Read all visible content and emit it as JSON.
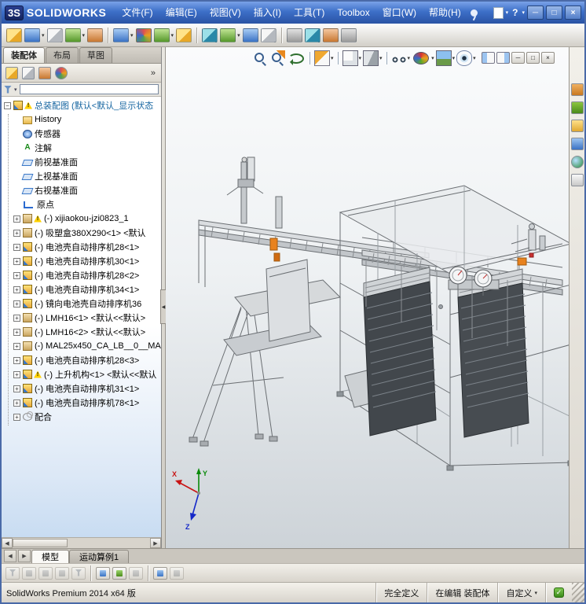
{
  "titlebar": {
    "logo_mark": "3S",
    "logo_text": "SOLIDWORKS",
    "menus": [
      "文件(F)",
      "编辑(E)",
      "视图(V)",
      "插入(I)",
      "工具(T)",
      "Toolbox",
      "窗口(W)",
      "帮助(H)"
    ]
  },
  "glyphs": {
    "plus": "+",
    "minus": "−",
    "warn": "!",
    "dropdown": "▾",
    "chevrons": "»",
    "left": "◀",
    "right": "▶",
    "minimize": "─",
    "maximize": "□",
    "close": "×",
    "help": "?",
    "check": "✓",
    "collapse": "◀"
  },
  "commandmanager": {
    "tabs": [
      "装配体",
      "布局",
      "草图"
    ]
  },
  "panel": {
    "filter_value": ""
  },
  "tree": {
    "items": [
      {
        "label": "总装配图 (默认<默认_显示状态",
        "warning": true
      },
      {
        "label": "History"
      },
      {
        "label": "传感器"
      },
      {
        "label": "注解"
      },
      {
        "label": "前视基准面"
      },
      {
        "label": "上视基准面"
      },
      {
        "label": "右视基准面"
      },
      {
        "label": "原点"
      },
      {
        "label": "(-) xijiaokou-jzi0823_1",
        "warning": true
      },
      {
        "label": "(-) 吸塑盒380X290<1> <默认"
      },
      {
        "label": "(-) 电池壳自动排序机28<1>"
      },
      {
        "label": "(-) 电池壳自动排序机30<1>"
      },
      {
        "label": "(-) 电池壳自动排序机28<2>"
      },
      {
        "label": "(-) 电池壳自动排序机34<1>"
      },
      {
        "label": "(-) 镜向电池壳自动排序机36"
      },
      {
        "label": "(-) LMH16<1> <默认<<默认>"
      },
      {
        "label": "(-) LMH16<2> <默认<<默认>"
      },
      {
        "label": "(-) MAL25x450_CA_LB__0__MA"
      },
      {
        "label": "(-) 电池壳自动排序机28<3>"
      },
      {
        "label": "(-) 上升机构<1> <默认<<默认",
        "warning": true
      },
      {
        "label": "(-) 电池壳自动排序机31<1>"
      },
      {
        "label": "(-) 电池壳自动排序机78<1>"
      },
      {
        "label": "配合"
      }
    ]
  },
  "icon_glyphs": {
    "annotations": "A"
  },
  "viewport": {
    "triad": {
      "x": "X",
      "y": "Y",
      "z": "Z"
    }
  },
  "doc_tabs": {
    "items": [
      "模型",
      "运动算例1"
    ]
  },
  "statusbar": {
    "product": "SolidWorks Premium 2014 x64 版",
    "define_status": "完全定义",
    "edit_status": "在编辑 装配体",
    "custom": "自定义"
  }
}
